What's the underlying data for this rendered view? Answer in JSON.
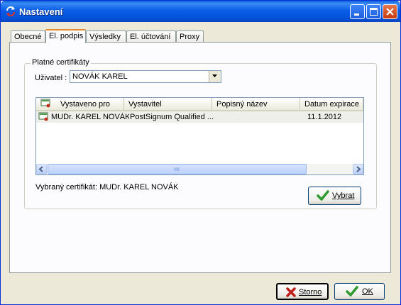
{
  "window": {
    "title": "Nastavení"
  },
  "tabs": [
    {
      "label": "Obecné"
    },
    {
      "label": "El. podpis"
    },
    {
      "label": "Výsledky"
    },
    {
      "label": "El. účtování"
    },
    {
      "label": "Proxy"
    }
  ],
  "group": {
    "label": "Platné certifikáty",
    "user_label": "Uživatel :",
    "user_value": "NOVÁK KAREL"
  },
  "list": {
    "columns": [
      "Vystaveno pro",
      "Vystavitel",
      "Popisný název",
      "Datum expirace"
    ],
    "rows": [
      {
        "issued_to": "MUDr.  KAREL NOVÁK",
        "issuer": "PostSignum Qualified ...",
        "name": "",
        "expiry": "11.1.2012"
      }
    ]
  },
  "selected_label": "Vybraný certifikát: MUDr. KAREL NOVÁK",
  "buttons": {
    "select": "Vybrat",
    "cancel": "Storno",
    "ok": "OK"
  }
}
